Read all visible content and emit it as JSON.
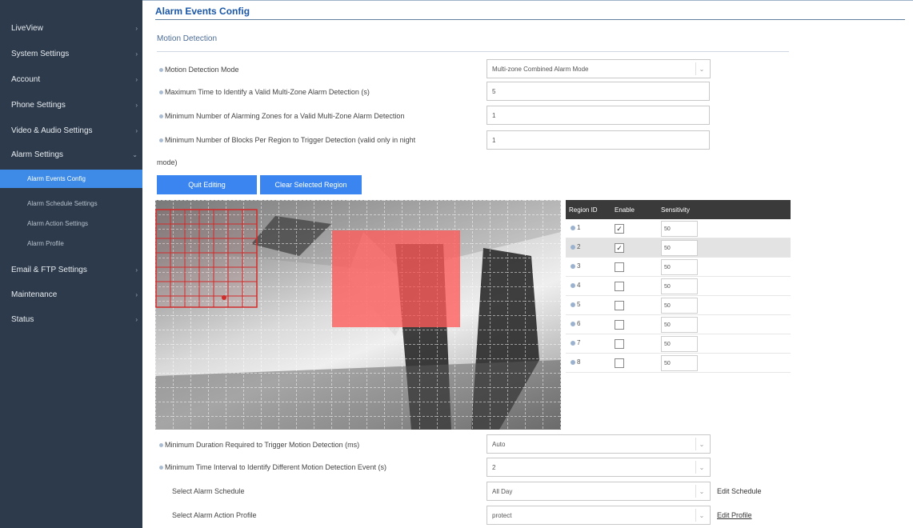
{
  "sidebar": {
    "items": [
      {
        "label": "LiveView"
      },
      {
        "label": "System Settings"
      },
      {
        "label": "Account"
      },
      {
        "label": "Phone Settings"
      },
      {
        "label": "Video & Audio Settings"
      },
      {
        "label": "Alarm Settings"
      },
      {
        "label": "Email & FTP Settings"
      },
      {
        "label": "Maintenance"
      },
      {
        "label": "Status"
      }
    ],
    "subitems": [
      {
        "label": "Alarm Events Config"
      },
      {
        "label": "Alarm Schedule Settings"
      },
      {
        "label": "Alarm Action Settings"
      },
      {
        "label": "Alarm Profile"
      }
    ]
  },
  "page": {
    "title": "Alarm Events Config",
    "section": "Motion Detection"
  },
  "form": {
    "mode_label": "Motion Detection Mode",
    "mode_value": "Multi-zone Combined Alarm Mode",
    "max_time_label": "Maximum Time to Identify a Valid Multi-Zone Alarm Detection (s)",
    "max_time_value": "5",
    "min_zones_label": "Minimum Number of Alarming Zones for a Valid Multi-Zone Alarm Detection",
    "min_zones_value": "1",
    "min_blocks_label": "Minimum Number of Blocks Per Region to Trigger Detection (valid only in night",
    "min_blocks_label_cont": "mode)",
    "min_blocks_value": "1",
    "min_duration_label": "Minimum Duration Required to Trigger Motion Detection (ms)",
    "min_duration_value": "Auto",
    "min_interval_label": "Minimum Time Interval to Identify Different Motion Detection Event (s)",
    "min_interval_value": "2",
    "schedule_label": "Select Alarm Schedule",
    "schedule_value": "All Day",
    "schedule_link": "Edit Schedule",
    "profile_label": "Select Alarm Action Profile",
    "profile_value": "protect",
    "profile_link": "Edit Profile"
  },
  "buttons": {
    "quit": "Quit Editing",
    "clear": "Clear Selected Region"
  },
  "region_table": {
    "headers": [
      "Region ID",
      "Enable",
      "Sensitivity"
    ],
    "rows": [
      {
        "id": "1",
        "enabled": true,
        "sensitivity": "50",
        "selected": false
      },
      {
        "id": "2",
        "enabled": true,
        "sensitivity": "50",
        "selected": true
      },
      {
        "id": "3",
        "enabled": false,
        "sensitivity": "50",
        "selected": false
      },
      {
        "id": "4",
        "enabled": false,
        "sensitivity": "50",
        "selected": false
      },
      {
        "id": "5",
        "enabled": false,
        "sensitivity": "50",
        "selected": false
      },
      {
        "id": "6",
        "enabled": false,
        "sensitivity": "50",
        "selected": false
      },
      {
        "id": "7",
        "enabled": false,
        "sensitivity": "50",
        "selected": false
      },
      {
        "id": "8",
        "enabled": false,
        "sensitivity": "50",
        "selected": false
      }
    ]
  },
  "icons": {
    "chevron": "chevron-down-icon",
    "arrow": "chevron-right-icon",
    "bullet": "info-dot-icon"
  },
  "colors": {
    "sidebar": "#2c3a4b",
    "active": "#3d8be6",
    "button": "#3a85f0",
    "region1": "#d22b2b",
    "region2": "#ff5a5a"
  }
}
